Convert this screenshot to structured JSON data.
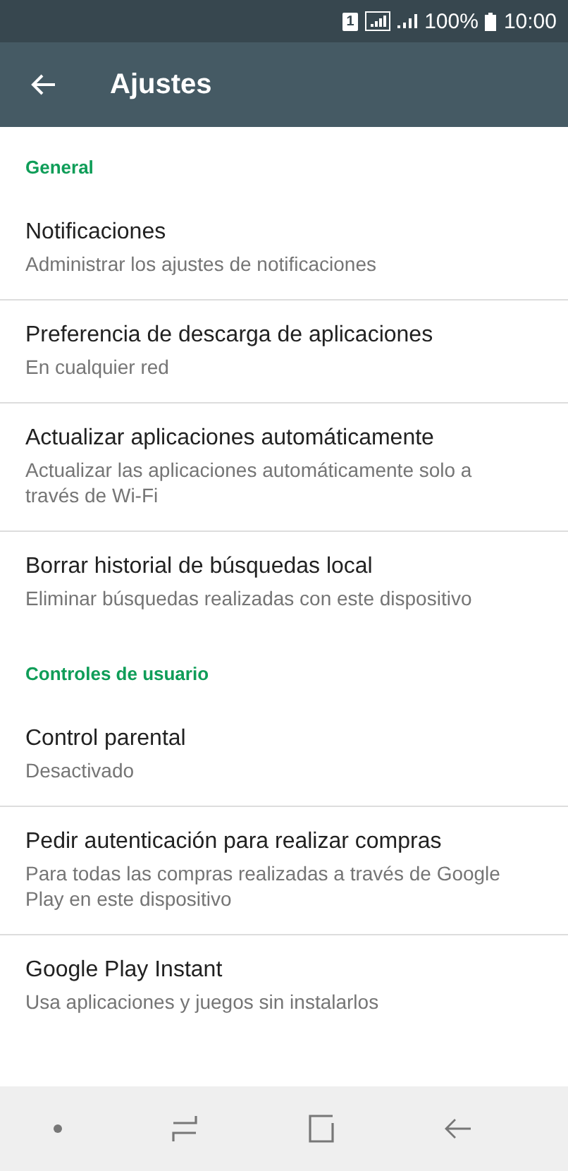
{
  "status_bar": {
    "sim": "1",
    "battery_text": "100%",
    "time": "10:00"
  },
  "app_bar": {
    "title": "Ajustes"
  },
  "sections": [
    {
      "header": "General",
      "items": [
        {
          "title": "Notificaciones",
          "subtitle": "Administrar los ajustes de notificaciones"
        },
        {
          "title": "Preferencia de descarga de aplicaciones",
          "subtitle": "En cualquier red"
        },
        {
          "title": "Actualizar aplicaciones automáticamente",
          "subtitle": "Actualizar las aplicaciones automáticamente solo a través de Wi-Fi"
        },
        {
          "title": "Borrar historial de búsquedas local",
          "subtitle": "Eliminar búsquedas realizadas con este dispositivo"
        }
      ]
    },
    {
      "header": "Controles de usuario",
      "items": [
        {
          "title": "Control parental",
          "subtitle": "Desactivado"
        },
        {
          "title": "Pedir autenticación para realizar compras",
          "subtitle": "Para todas las compras realizadas a través de Google Play en este dispositivo"
        },
        {
          "title": "Google Play Instant",
          "subtitle": "Usa aplicaciones y juegos sin instalarlos"
        }
      ]
    }
  ]
}
